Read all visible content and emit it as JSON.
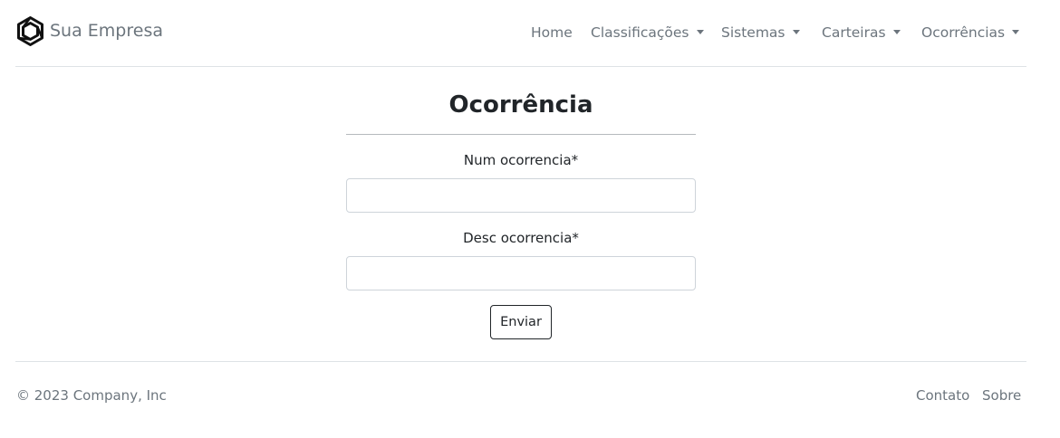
{
  "brand": {
    "name": "Sua Empresa",
    "logo_icon": "hexagon-cube-logo-icon"
  },
  "nav": {
    "home": "Home",
    "classificacoes": "Classificações",
    "sistemas": "Sistemas",
    "carteiras": "Carteiras",
    "ocorrencias": "Ocorrências"
  },
  "form": {
    "title": "Ocorrência",
    "num_label": "Num ocorrencia*",
    "num_value": "",
    "desc_label": "Desc ocorrencia*",
    "desc_value": "",
    "submit_label": "Enviar"
  },
  "footer": {
    "copyright": "© 2023 Company, Inc",
    "contato": "Contato",
    "sobre": "Sobre"
  },
  "colors": {
    "text": "#212529",
    "muted": "#6c757d",
    "border": "#dee2e6",
    "input_border": "#ced4da"
  }
}
